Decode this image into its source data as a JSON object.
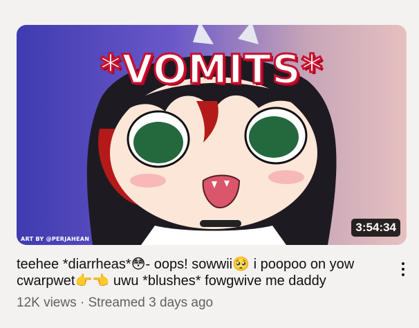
{
  "video": {
    "thumbnail": {
      "overlay_text": "*VOMITS*",
      "credit_text": "ART BY @PERJAHEAN",
      "duration": "3:54:34",
      "colors": {
        "bg_left": "#3f3bb0",
        "bg_right": "#e6c0c0",
        "overlay_fill": "#ffffff",
        "overlay_stroke": "#c8102e"
      }
    },
    "title": "teehee *diarrheas*😳- oops! sowwii🥺 i poopoo on yow cwarpwet👉👈 uwu *blushes* fowgwive me daddy",
    "views": "12K views",
    "separator": "·",
    "streamed": "Streamed 3 days ago",
    "menu_icon": "more-vert-icon"
  }
}
